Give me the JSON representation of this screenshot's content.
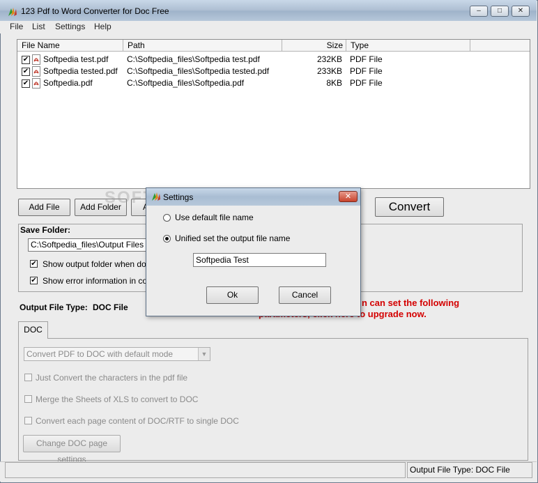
{
  "window": {
    "title": "123 Pdf to Word Converter for Doc Free",
    "minimize": "–",
    "maximize": "□",
    "close": "✕"
  },
  "menu": [
    "File",
    "List",
    "Settings",
    "Help"
  ],
  "filelist": {
    "columns": [
      "File Name",
      "Path",
      "Size",
      "Type"
    ],
    "rows": [
      {
        "checked": true,
        "name": "Softpedia test.pdf",
        "path": "C:\\Softpedia_files\\Softpedia test.pdf",
        "size": "232KB",
        "type": "PDF File"
      },
      {
        "checked": true,
        "name": "Softpedia tested.pdf",
        "path": "C:\\Softpedia_files\\Softpedia tested.pdf",
        "size": "233KB",
        "type": "PDF File"
      },
      {
        "checked": true,
        "name": "Softpedia.pdf",
        "path": "C:\\Softpedia_files\\Softpedia.pdf",
        "size": "8KB",
        "type": "PDF File"
      }
    ]
  },
  "buttons": {
    "add_file": "Add File",
    "add_folder": "Add Folder",
    "partial": "A",
    "convert": "Convert"
  },
  "save": {
    "label": "Save Folder:",
    "path": "C:\\Softpedia_files\\Output Files",
    "show_output": "Show output folder when done",
    "show_error": "Show error information in conve",
    "show_output_checked": true,
    "show_error_checked": true
  },
  "output_type": {
    "label": "Output File Type:",
    "value": "DOC File"
  },
  "upgrade": {
    "line1": "n can set the following",
    "line2": "parameters, click here to upgrade now."
  },
  "doc_tab": {
    "tab_label": "DOC",
    "mode_select": "Convert PDF to DOC with default mode",
    "opt1": "Just Convert the characters in the pdf file",
    "opt2": "Merge the Sheets of XLS to convert to DOC",
    "opt3": "Convert each page content of DOC/RTF to single DOC",
    "page_settings_button": "Change DOC page settings"
  },
  "status": {
    "left": "",
    "right": "Output File Type:  DOC File"
  },
  "watermark": "SOFTPEDIA",
  "dialog": {
    "title": "Settings",
    "close": "✕",
    "option_default": "Use default file name",
    "option_unified": "Unified set the output file name",
    "selected": "unified",
    "filename": "Softpedia Test",
    "ok": "Ok",
    "cancel": "Cancel"
  },
  "colors": {
    "upgrade_text": "#d40000",
    "titlebar": "#aebfd3"
  }
}
